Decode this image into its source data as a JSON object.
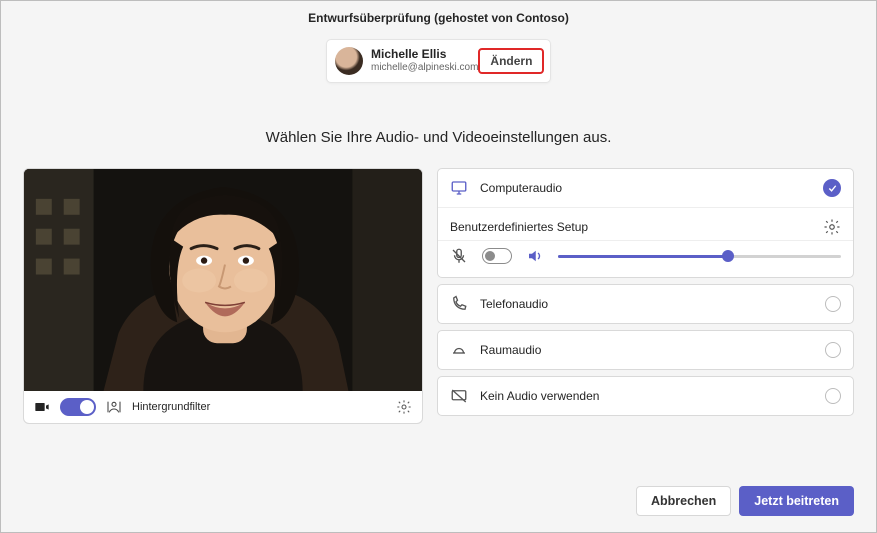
{
  "title": "Entwurfsüberprüfung (gehostet von Contoso)",
  "identity": {
    "display_name": "Michelle Ellis",
    "email": "michelle@alpineski.com",
    "change_label": "Ändern"
  },
  "instruction": "Wählen Sie Ihre Audio- und Videoeinstellungen aus.",
  "video": {
    "camera_on": true,
    "bg_filter_label": "Hintergrundfilter"
  },
  "audio_options": {
    "computer": {
      "label": "Computeraudio",
      "selected": true
    },
    "custom_setup_label": "Benutzerdefiniertes Setup",
    "mic_muted": true,
    "volume_percent": 60,
    "phone": {
      "label": "Telefonaudio",
      "selected": false
    },
    "room": {
      "label": "Raumaudio",
      "selected": false
    },
    "none": {
      "label": "Kein Audio verwenden",
      "selected": false
    }
  },
  "actions": {
    "cancel_label": "Abbrechen",
    "join_label": "Jetzt beitreten"
  },
  "colors": {
    "accent": "#5b5fc7"
  }
}
